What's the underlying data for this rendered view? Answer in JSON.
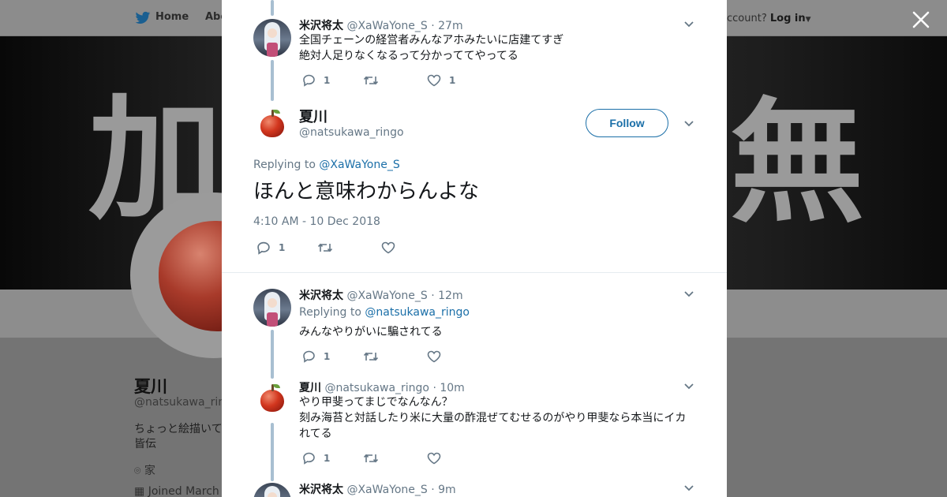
{
  "background": {
    "nav_home": "Home",
    "nav_about": "Abo",
    "account_prompt": "ccount?",
    "login_label": "Log in",
    "banner_left_kanji": "加",
    "banner_right_kanji": "無",
    "profile_name": "夏川",
    "profile_handle": "@natsukawa_ring",
    "bio_line1": "ちょっと絵描いて",
    "bio_line2": "皆伝",
    "location": "家",
    "joined": "Joined March"
  },
  "thread": [
    {
      "name": "米沢将太",
      "handle": "@XaWaYone_S",
      "time": "· 27m",
      "lines": [
        "全国チェーンの経営者みんなアホみたいに店建てすぎ",
        "絶対人足りなくなるって分かっててやってる"
      ],
      "replies": "1",
      "retweets": "",
      "likes": "1"
    },
    {
      "name": "米沢将太",
      "handle": "@XaWaYone_S",
      "time": "· 12m",
      "replying_prefix": "Replying to",
      "replying_to": "@natsukawa_ringo",
      "lines": [
        "みんなやりがいに騙されてる"
      ],
      "replies": "1",
      "retweets": "",
      "likes": ""
    },
    {
      "name": "夏川",
      "handle": "@natsukawa_ringo",
      "time": "· 10m",
      "lines": [
        "やり甲斐ってまじでなんなん？",
        "刻み海苔と対話したり米に大量の酢混ぜてむせるのがやり甲斐なら本当にイカ",
        "れてる"
      ],
      "replies": "1",
      "retweets": "",
      "likes": ""
    },
    {
      "name": "米沢将太",
      "handle": "@XaWaYone_S",
      "time": "· 9m"
    }
  ],
  "main_tweet": {
    "name": "夏川",
    "handle": "@natsukawa_ringo",
    "follow_label": "Follow",
    "replying_prefix": "Replying to",
    "replying_to": "@XaWaYone_S",
    "text": "ほんと意味わからんよな",
    "timestamp": "4:10 AM - 10 Dec 2018",
    "replies": "1",
    "retweets": "",
    "likes": ""
  },
  "colors": {
    "link": "#1b6fa8",
    "muted": "#657786",
    "thread_line": "#a8bfd1"
  }
}
